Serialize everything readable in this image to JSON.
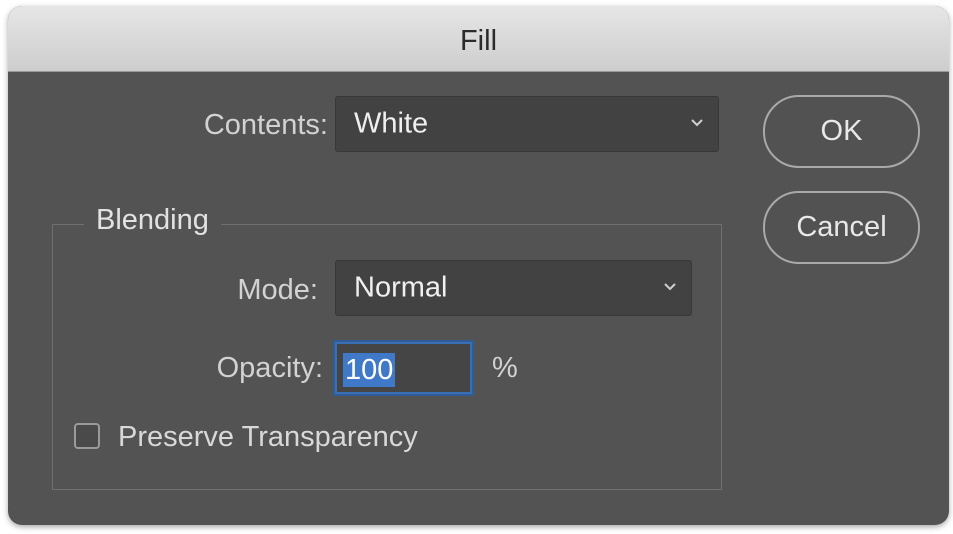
{
  "dialog": {
    "title": "Fill",
    "contents": {
      "label": "Contents:",
      "value": "White",
      "icon": "chevron-down-icon"
    },
    "buttons": {
      "ok": "OK",
      "cancel": "Cancel"
    },
    "blending": {
      "legend": "Blending",
      "mode": {
        "label": "Mode:",
        "value": "Normal",
        "icon": "chevron-down-icon"
      },
      "opacity": {
        "label": "Opacity:",
        "value": "100",
        "unit": "%"
      },
      "preserve_transparency": {
        "label": "Preserve Transparency",
        "checked": false
      }
    },
    "colors": {
      "background": "#535353",
      "titlebar": "#d8d8d8",
      "selection": "#3f79c8"
    }
  }
}
